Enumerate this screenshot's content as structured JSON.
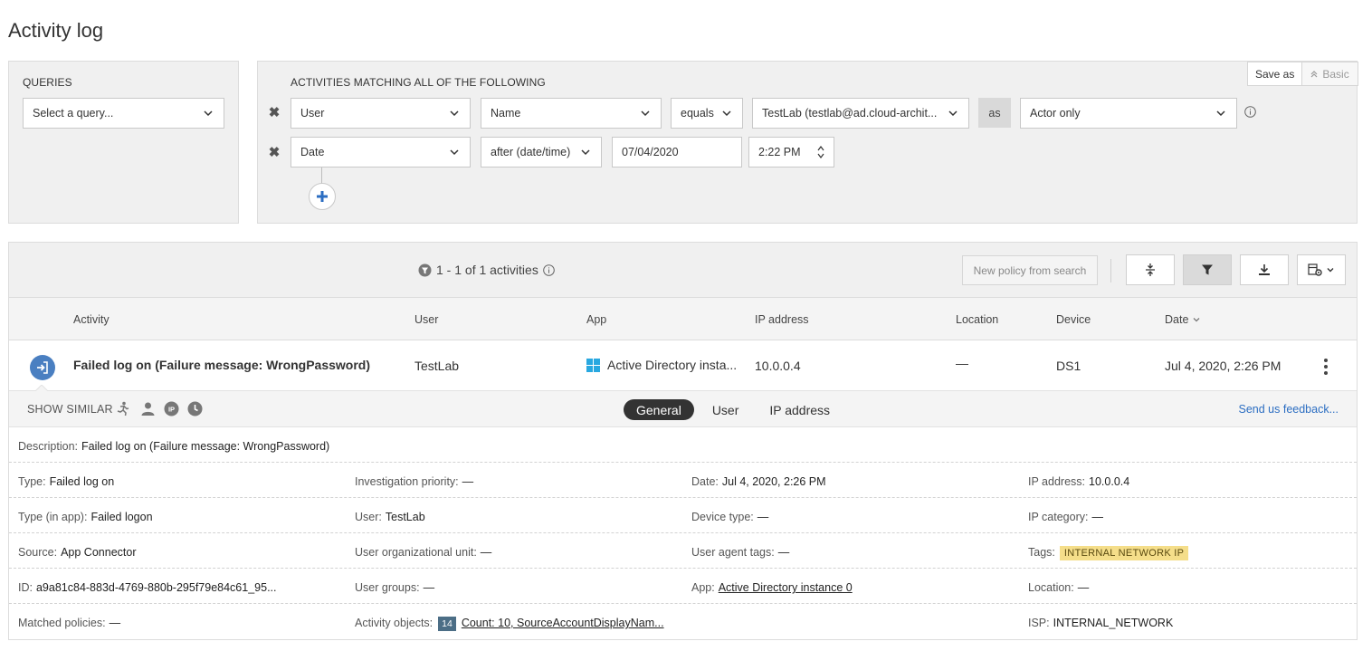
{
  "page": {
    "title": "Activity log"
  },
  "queries": {
    "heading": "QUERIES",
    "select_placeholder": "Select a query..."
  },
  "filters": {
    "heading": "ACTIVITIES MATCHING ALL OF THE FOLLOWING",
    "save_as": "Save as",
    "basic": "Basic",
    "row1": {
      "field": "User",
      "attribute": "Name",
      "operator": "equals",
      "value": "TestLab (testlab@ad.cloud-archit...",
      "as_label": "as",
      "role": "Actor only"
    },
    "row2": {
      "field": "Date",
      "operator": "after (date/time)",
      "date": "07/04/2020",
      "time": "2:22 PM"
    }
  },
  "toolbar": {
    "result_count": "1 - 1 of 1 activities",
    "new_policy": "New policy from search"
  },
  "table": {
    "headers": {
      "activity": "Activity",
      "user": "User",
      "app": "App",
      "ip": "IP address",
      "location": "Location",
      "device": "Device",
      "date": "Date"
    },
    "rows": [
      {
        "activity": "Failed log on (Failure message: WrongPassword)",
        "user": "TestLab",
        "app": "Active Directory insta...",
        "ip": "10.0.0.4",
        "location": "—",
        "device": "DS1",
        "date": "Jul 4, 2020, 2:26 PM"
      }
    ]
  },
  "details": {
    "show_similar": "SHOW SIMILAR",
    "tabs": [
      "General",
      "User",
      "IP address"
    ],
    "feedback": "Send us feedback...",
    "description": {
      "label": "Description:",
      "value": "Failed log on (Failure message: WrongPassword)"
    },
    "type": {
      "label": "Type:",
      "value": "Failed log on"
    },
    "investigation_priority": {
      "label": "Investigation priority:",
      "value": "—"
    },
    "date": {
      "label": "Date:",
      "value": "Jul 4, 2020, 2:26 PM"
    },
    "ip_address": {
      "label": "IP address:",
      "value": "10.0.0.4"
    },
    "type_in_app": {
      "label": "Type (in app):",
      "value": "Failed logon"
    },
    "user": {
      "label": "User:",
      "value": "TestLab"
    },
    "device_type": {
      "label": "Device type:",
      "value": "—"
    },
    "ip_category": {
      "label": "IP category:",
      "value": "—"
    },
    "source": {
      "label": "Source:",
      "value": "App Connector"
    },
    "user_ou": {
      "label": "User organizational unit:",
      "value": "—"
    },
    "user_agent_tags": {
      "label": "User agent tags:",
      "value": "—"
    },
    "tags": {
      "label": "Tags:",
      "value": "INTERNAL NETWORK IP"
    },
    "id": {
      "label": "ID:",
      "value": "a9a81c84-883d-4769-880b-295f79e84c61_95..."
    },
    "user_groups": {
      "label": "User groups:",
      "value": "—"
    },
    "app": {
      "label": "App:",
      "value": "Active Directory instance 0"
    },
    "location": {
      "label": "Location:",
      "value": "—"
    },
    "matched_policies": {
      "label": "Matched policies:",
      "value": "—"
    },
    "activity_objects": {
      "label": "Activity objects:",
      "count": "14",
      "value": "Count: 10, SourceAccountDisplayNam..."
    },
    "isp": {
      "label": "ISP:",
      "value": "INTERNAL_NETWORK"
    }
  },
  "colors": {
    "accent_blue": "#2c6ec2",
    "activity_icon": "#4a7fc1",
    "tag_yellow": "#f5de8a",
    "count_chip": "#4c6e86",
    "panel_bg": "#f0f0f0"
  }
}
